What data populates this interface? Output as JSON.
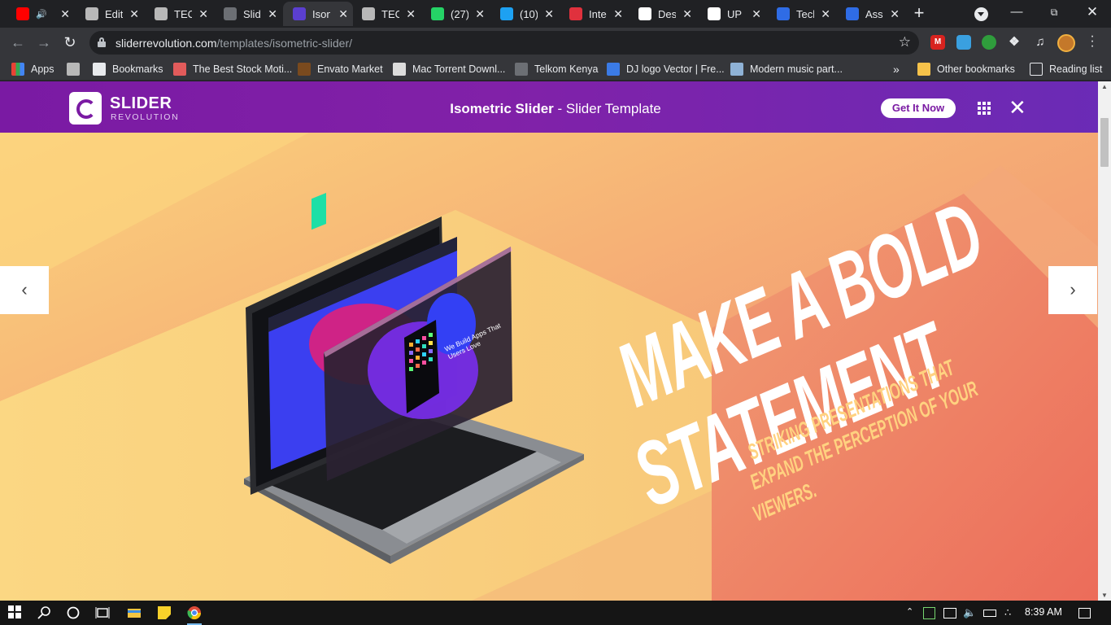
{
  "browser": {
    "tabs": [
      {
        "title": "",
        "icon": "youtube-icon",
        "color": "#ff0000",
        "audio": true
      },
      {
        "title": "Edit",
        "icon": "site-icon",
        "color": "#b8b8b8"
      },
      {
        "title": "TEC",
        "icon": "site-icon",
        "color": "#b8b8b8"
      },
      {
        "title": "Slid",
        "icon": "globe-icon",
        "color": "#6c6f74"
      },
      {
        "title": "Ison",
        "icon": "slider-revolution-icon",
        "color": "#5b3fd0",
        "active": true
      },
      {
        "title": "TEC",
        "icon": "site-icon",
        "color": "#b8b8b8"
      },
      {
        "title": "(27)",
        "icon": "whatsapp-icon",
        "color": "#25d366"
      },
      {
        "title": "(10)",
        "icon": "twitter-icon",
        "color": "#1da1f2"
      },
      {
        "title": "Inte",
        "icon": "gauge-icon",
        "color": "#e0313d"
      },
      {
        "title": "Des",
        "icon": "medium-icon",
        "color": "#ffffff"
      },
      {
        "title": "UP",
        "icon": "medium-icon",
        "color": "#ffffff"
      },
      {
        "title": "Tech",
        "icon": "site-icon",
        "color": "#2f6ce5"
      },
      {
        "title": "Ass",
        "icon": "site-icon",
        "color": "#2f6ce5"
      }
    ],
    "url_host": "sliderrevolution.com",
    "url_path": "/templates/isometric-slider/",
    "bookmarks": [
      {
        "label": "Apps",
        "icon": "apps-grid-icon"
      },
      {
        "label": "",
        "icon": "site-icon"
      },
      {
        "label": "Bookmarks",
        "icon": "star-icon"
      },
      {
        "label": "The Best Stock Moti...",
        "icon": "motion-icon"
      },
      {
        "label": "Envato Market",
        "icon": "envato-icon"
      },
      {
        "label": "Mac Torrent Downl...",
        "icon": "torrent-icon"
      },
      {
        "label": "Telkom Kenya",
        "icon": "telkom-icon"
      },
      {
        "label": "DJ logo Vector | Fre...",
        "icon": "dj-icon"
      },
      {
        "label": "Modern music part...",
        "icon": "music-icon"
      }
    ],
    "more_bookmarks": "»",
    "other_bookmarks": "Other bookmarks",
    "reading_list": "Reading list"
  },
  "header": {
    "brand_name": "SLIDER",
    "brand_sub": "REVOLUTION",
    "title_bold": "Isometric Slider",
    "title_rest": " - Slider Template",
    "cta_label": "Get It Now"
  },
  "slide": {
    "headline_line1": "MAKE A BOLD",
    "headline_line2": "STATEMENT",
    "sub_line1": "STRIKING PRESENTATIONS THAT",
    "sub_line2": "EXPAND THE PERCEPTION OF YOUR",
    "sub_line3": "VIEWERS.",
    "prev_arrow": "‹",
    "next_arrow": "›",
    "screen_label": "We Build Apps That Users Love"
  },
  "taskbar": {
    "time": "8:39 AM"
  }
}
